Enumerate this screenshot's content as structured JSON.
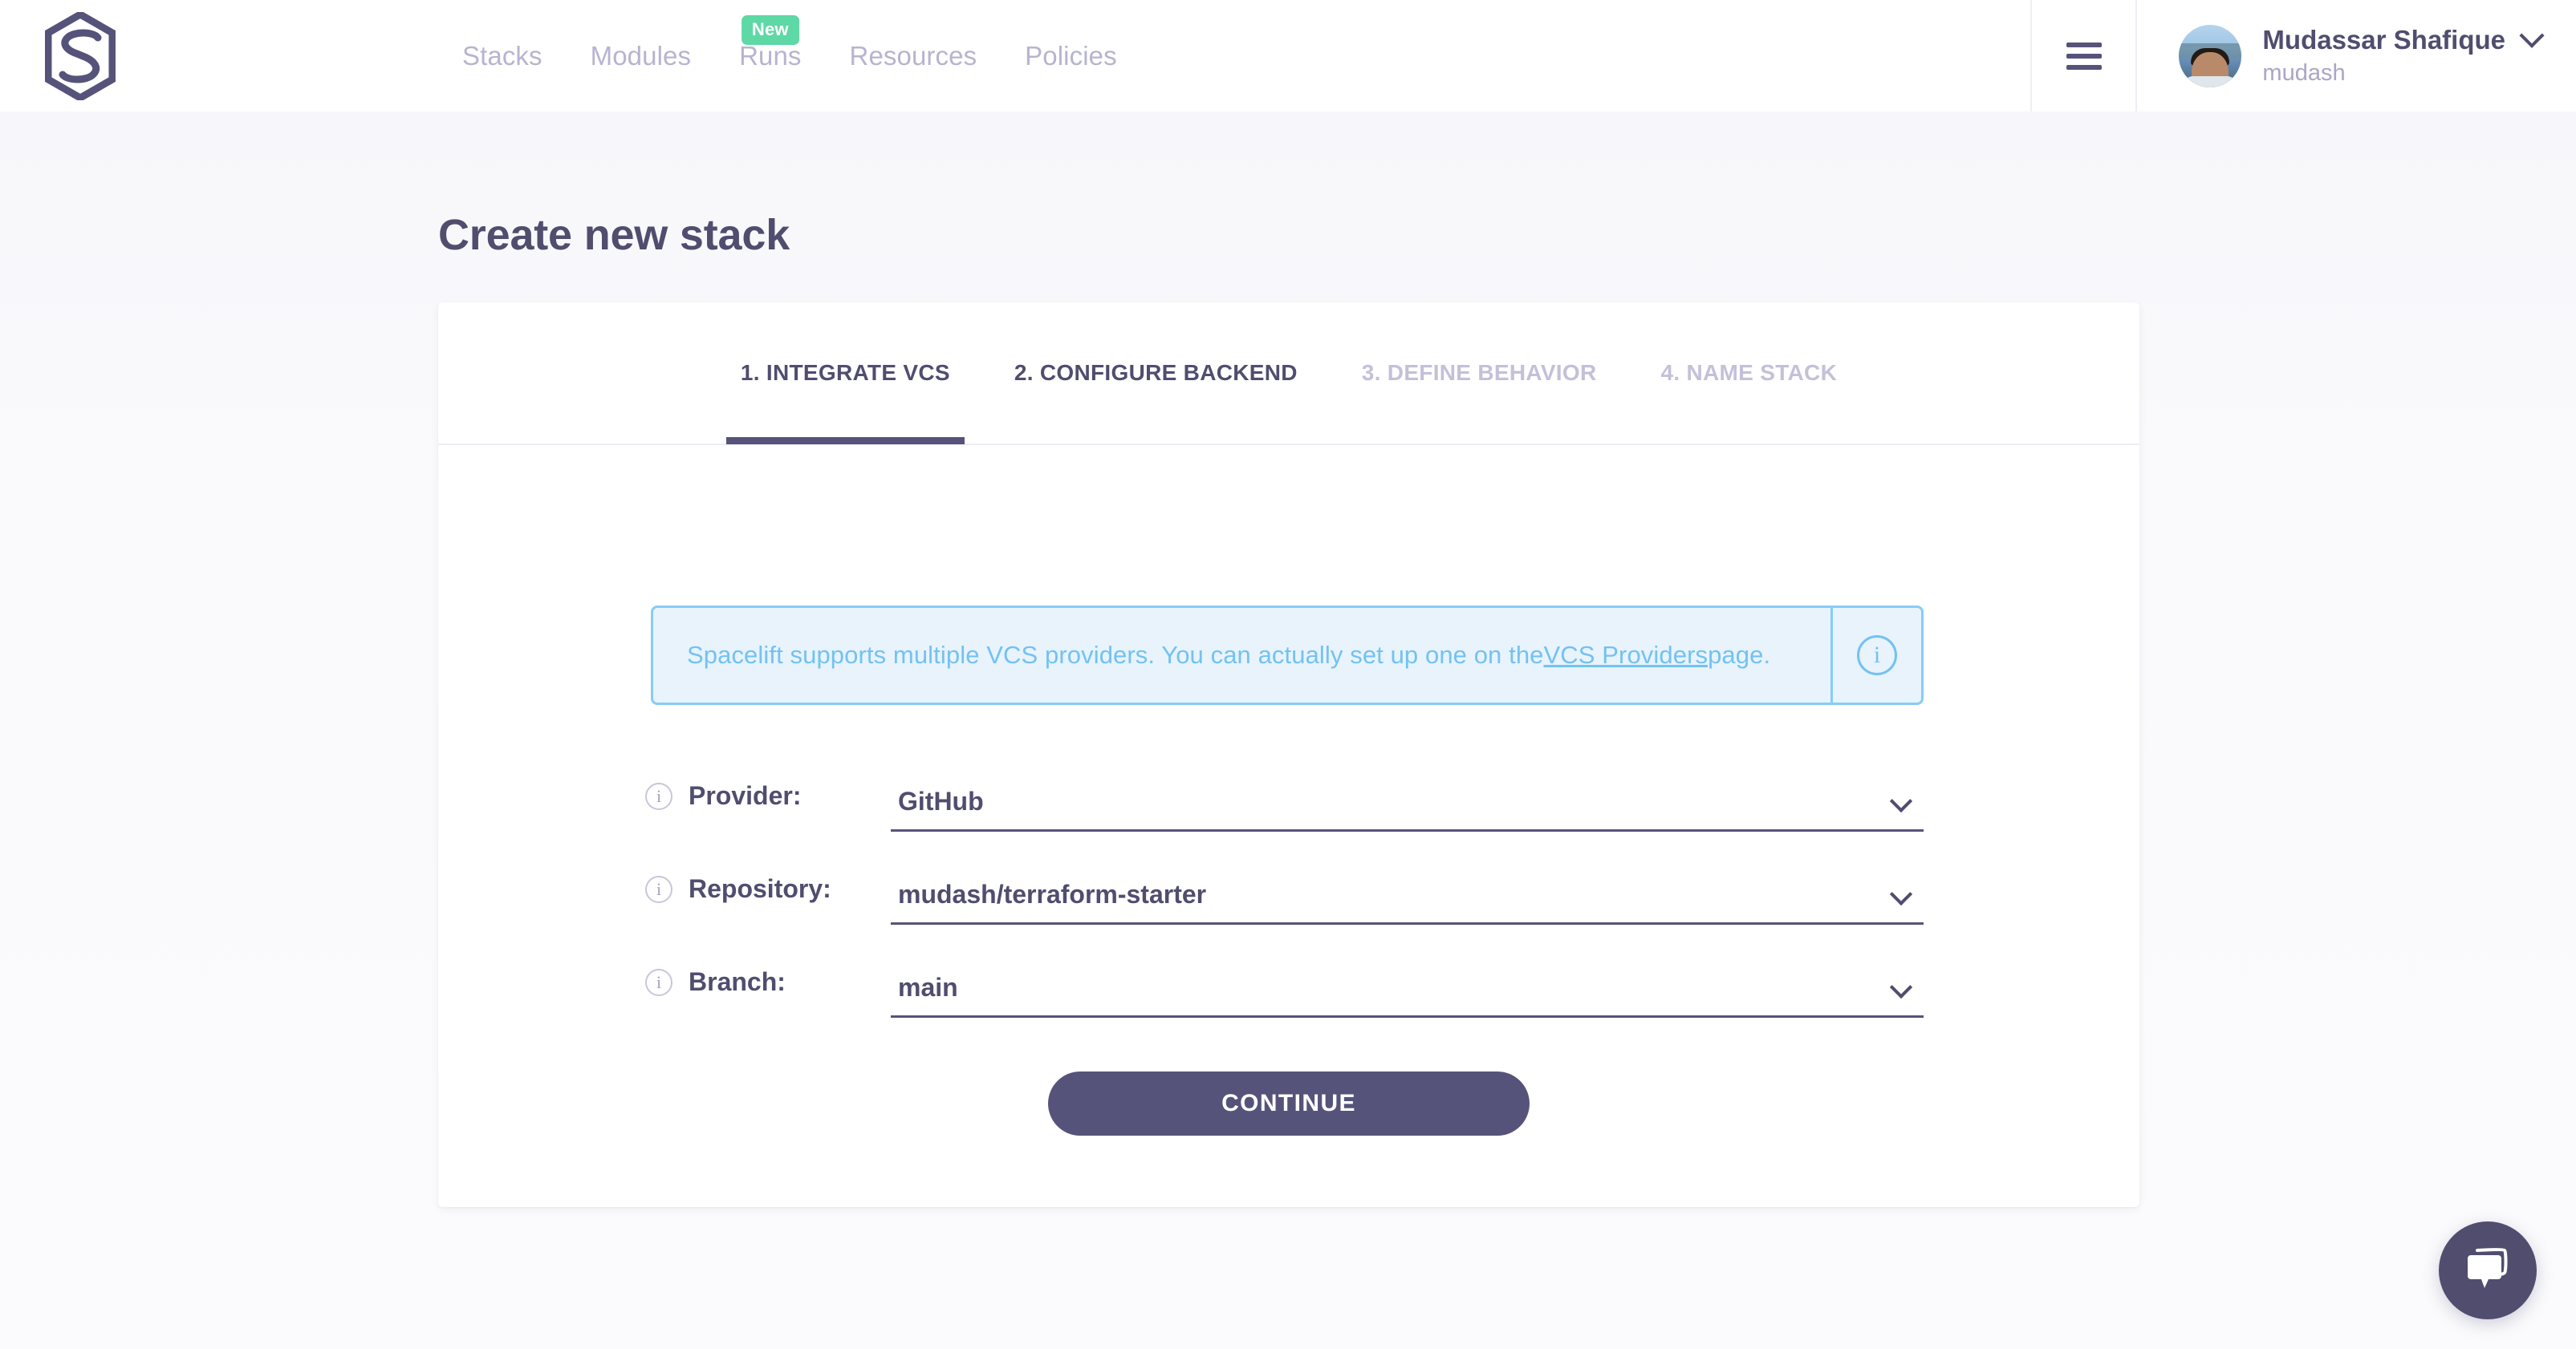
{
  "header": {
    "logo_name": "spacelift-logo",
    "nav": [
      {
        "label": "Stacks",
        "badge": null
      },
      {
        "label": "Modules",
        "badge": null
      },
      {
        "label": "Runs",
        "badge": "New"
      },
      {
        "label": "Resources",
        "badge": null
      },
      {
        "label": "Policies",
        "badge": null
      }
    ],
    "menu_icon": "hamburger-icon",
    "user": {
      "name": "Mudassar Shafique",
      "handle": "mudash",
      "caret": "chevron-down-icon"
    }
  },
  "page": {
    "title": "Create new stack"
  },
  "wizard": {
    "tabs": [
      {
        "label": "1. INTEGRATE VCS",
        "state": "active"
      },
      {
        "label": "2. CONFIGURE BACKEND",
        "state": "enabled"
      },
      {
        "label": "3. DEFINE BEHAVIOR",
        "state": "disabled"
      },
      {
        "label": "4. NAME STACK",
        "state": "disabled"
      }
    ]
  },
  "banner": {
    "text_before": "Spacelift supports multiple VCS providers. You can actually set up one on the ",
    "link": "VCS Providers",
    "text_after": " page.",
    "icon": "info-circle-icon",
    "border_color": "#86cdf5",
    "background_color": "#e8f3fc",
    "text_color": "#73c2f2"
  },
  "form": {
    "fields": [
      {
        "label": "Provider:",
        "value": "GitHub",
        "info_icon": "info-circle-icon",
        "caret": "chevron-down-icon"
      },
      {
        "label": "Repository:",
        "value": "mudash/terraform-starter",
        "info_icon": "info-circle-icon",
        "caret": "chevron-down-icon"
      },
      {
        "label": "Branch:",
        "value": "main",
        "info_icon": "info-circle-icon",
        "caret": "chevron-down-icon"
      }
    ]
  },
  "actions": {
    "continue_label": "CONTINUE"
  },
  "chat": {
    "icon": "chat-bubble-icon",
    "color": "#504d6f"
  },
  "theme": {
    "primary": "#56537a",
    "text_dark": "#504d6f",
    "text_muted": "#b7b4cf",
    "badge_green": "#5ed8a5",
    "page_bg": "#f8f8fb"
  }
}
